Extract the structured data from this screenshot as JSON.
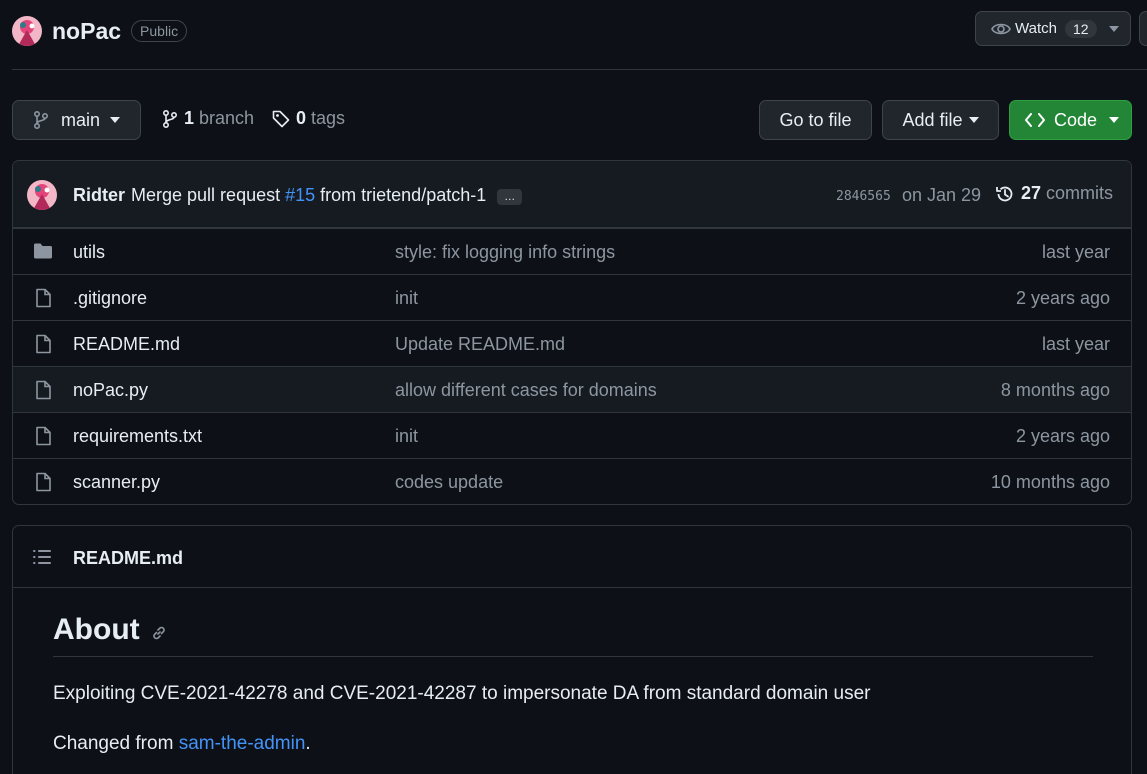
{
  "repo": {
    "name": "noPac",
    "visibility": "Public",
    "watch_label": "Watch",
    "watch_count": "12"
  },
  "toolbar": {
    "branch_name": "main",
    "branch_count": "1",
    "branch_label": "branch",
    "tag_count": "0",
    "tag_label": "tags",
    "goto_file": "Go to file",
    "add_file": "Add file",
    "code": "Code"
  },
  "commit": {
    "author": "Ridter",
    "message_prefix": "Merge pull request",
    "pr_link": "#15",
    "message_suffix": "from trietend/patch-1",
    "ellipsis": "…",
    "sha": "2846565",
    "date": "on Jan 29",
    "commit_count": "27",
    "commits_label": "commits"
  },
  "files": [
    {
      "name": "utils",
      "type": "folder",
      "message": "style: fix logging info strings",
      "age": "last year"
    },
    {
      "name": ".gitignore",
      "type": "file",
      "message": "init",
      "age": "2 years ago"
    },
    {
      "name": "README.md",
      "type": "file",
      "message": "Update README.md",
      "age": "last year"
    },
    {
      "name": "noPac.py",
      "type": "file",
      "message": "allow different cases for domains",
      "age": "8 months ago"
    },
    {
      "name": "requirements.txt",
      "type": "file",
      "message": "init",
      "age": "2 years ago"
    },
    {
      "name": "scanner.py",
      "type": "file",
      "message": "codes update",
      "age": "10 months ago"
    }
  ],
  "readme": {
    "header": "README.md",
    "heading": "About",
    "paragraph1": "Exploiting CVE-2021-42278 and CVE-2021-42287 to impersonate DA from standard domain user",
    "changed_prefix": "Changed from",
    "changed_link": "sam-the-admin",
    "changed_suffix": "."
  },
  "colors": {
    "background": "#0d1117",
    "panel": "#161b22",
    "border": "#30363d",
    "accent_link": "#4493f8",
    "primary_button": "#238636"
  }
}
